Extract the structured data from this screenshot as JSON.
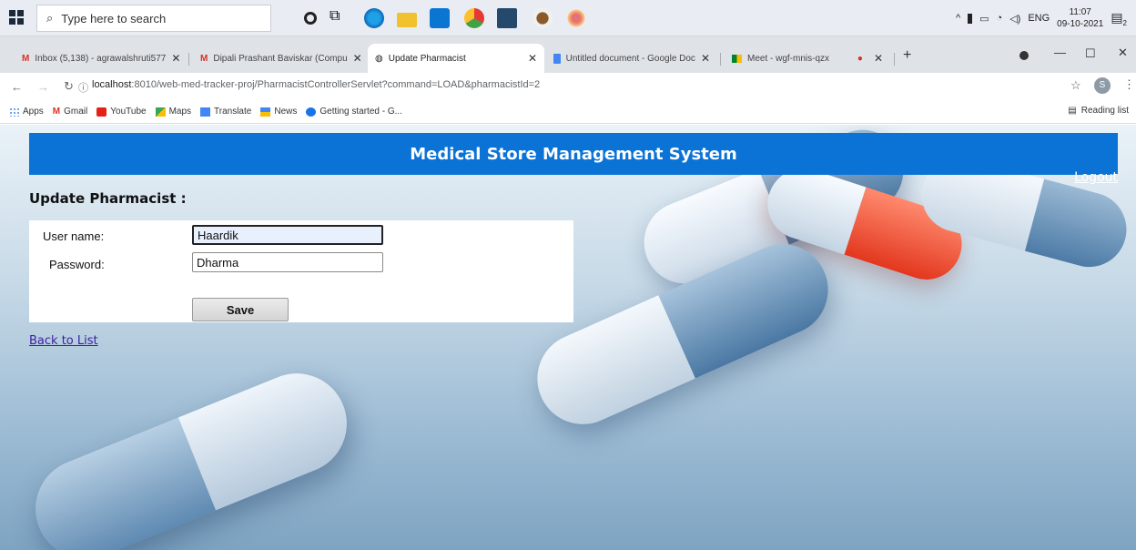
{
  "taskbar": {
    "search_placeholder": "Type here to search",
    "tray": {
      "language": "ENG",
      "time": "11:07",
      "date": "09-10-2021",
      "notification_count": "2"
    }
  },
  "tabs": [
    {
      "label": "Inbox (5,138) - agrawalshruti577",
      "icon": "gmail-icon"
    },
    {
      "label": "Dipali Prashant Baviskar (Compu",
      "icon": "gmail-icon"
    },
    {
      "label": "Update Pharmacist",
      "icon": "globe-icon",
      "active": true
    },
    {
      "label": "Untitled document - Google Doc",
      "icon": "docs-icon"
    },
    {
      "label": "Meet - wgf-mnis-qzx",
      "icon": "meet-icon"
    }
  ],
  "address_bar": {
    "host": "localhost",
    "path": ":8010/web-med-tracker-proj/PharmacistControllerServlet?command=LOAD&pharmacistId=2"
  },
  "bookmarks": [
    "Apps",
    "Gmail",
    "YouTube",
    "Maps",
    "Translate",
    "News",
    "Getting started - G..."
  ],
  "reading_list": "Reading list",
  "profile_initial": "S",
  "page": {
    "header_title": "Medical Store Management System",
    "logout_label": "Logout",
    "title": "Update Pharmacist :",
    "form": {
      "username_label": "User name:",
      "username_value": "Haardik",
      "password_label": "Password:",
      "password_value": "Dharma",
      "save_label": "Save"
    },
    "back_link": "Back to List"
  },
  "colors": {
    "header": "#0b73d6",
    "link": "#3b1ea0",
    "logout": "#ffffff"
  }
}
